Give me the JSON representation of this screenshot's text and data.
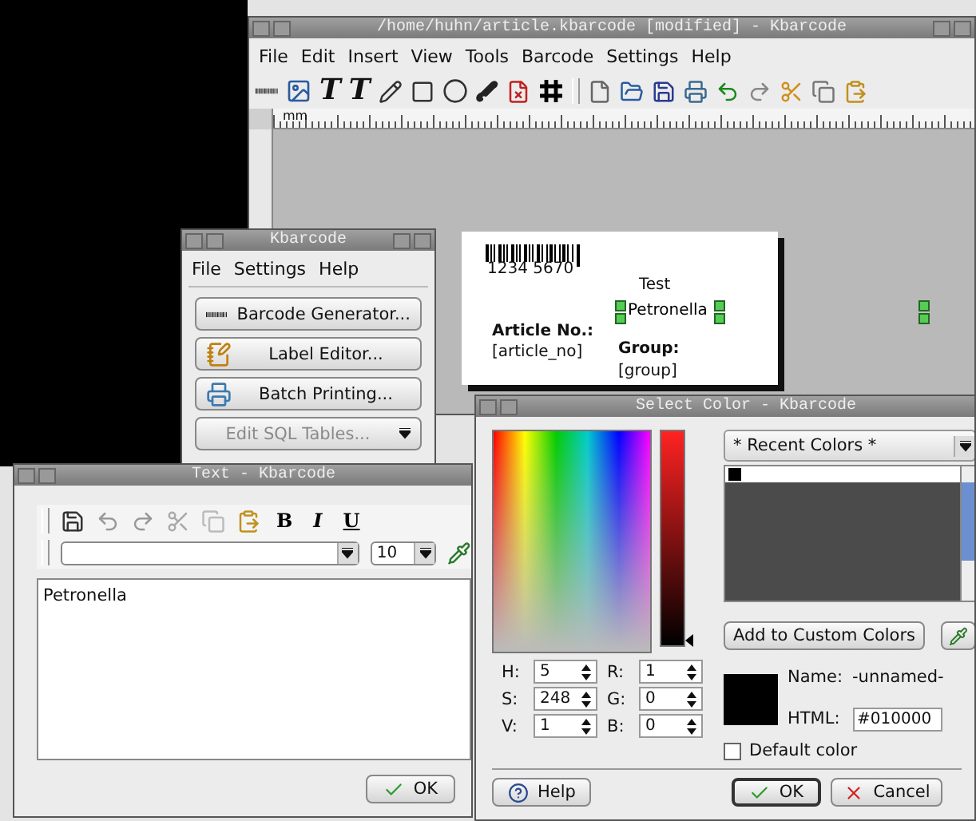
{
  "main_window": {
    "title": "/home/huhn/article.kbarcode [modified] - Kbarcode",
    "menu": [
      "File",
      "Edit",
      "Insert",
      "View",
      "Tools",
      "Barcode",
      "Settings",
      "Help"
    ],
    "text_tools": [
      "T",
      "T"
    ],
    "ruler_unit": "mm",
    "label": {
      "barcode_digits": "1234 5670",
      "texts": [
        {
          "text": "Test",
          "bold": false,
          "selected": false
        },
        {
          "text": "Petronella",
          "bold": false,
          "selected": true
        },
        {
          "text": "Article No.:",
          "bold": true,
          "selected": false
        },
        {
          "text": "[article_no]",
          "bold": false,
          "selected": false
        },
        {
          "text": "Group:",
          "bold": true,
          "selected": false
        },
        {
          "text": "[group]",
          "bold": false,
          "selected": false
        }
      ]
    }
  },
  "launcher": {
    "title": "Kbarcode",
    "menu": [
      "File",
      "Settings",
      "Help"
    ],
    "buttons": [
      {
        "label": "Barcode Generator...",
        "disabled": false
      },
      {
        "label": "Label Editor...",
        "disabled": false
      },
      {
        "label": "Batch Printing...",
        "disabled": false
      },
      {
        "label": "Edit SQL Tables...",
        "disabled": true
      }
    ]
  },
  "text_window": {
    "title": "Text - Kbarcode",
    "format_buttons": [
      "B",
      "I",
      "U"
    ],
    "font_size": "10",
    "content": "Petronella",
    "ok_button": "OK"
  },
  "color_dialog": {
    "title": "Select Color - Kbarcode",
    "value_slider": {
      "level": 0.0
    },
    "palette": "* Recent Colors *",
    "recent_colors": [
      {
        "color": "#000000"
      }
    ],
    "add_button": "Add to Custom Colors",
    "components": [
      {
        "label": "H:",
        "value": "5"
      },
      {
        "label": "R:",
        "value": "1"
      },
      {
        "label": "S:",
        "value": "248"
      },
      {
        "label": "G:",
        "value": "0"
      },
      {
        "label": "V:",
        "value": "1"
      },
      {
        "label": "B:",
        "value": "0"
      }
    ],
    "name_label": "Name:",
    "name_value": "-unnamed-",
    "html_label": "HTML:",
    "html_value": "#010000",
    "default_color": {
      "label": "Default color",
      "checked": false
    },
    "buttons": [
      {
        "label": "Help",
        "kind": "help"
      },
      {
        "label": "OK",
        "kind": "ok"
      },
      {
        "label": "Cancel",
        "kind": "cancel"
      }
    ]
  }
}
